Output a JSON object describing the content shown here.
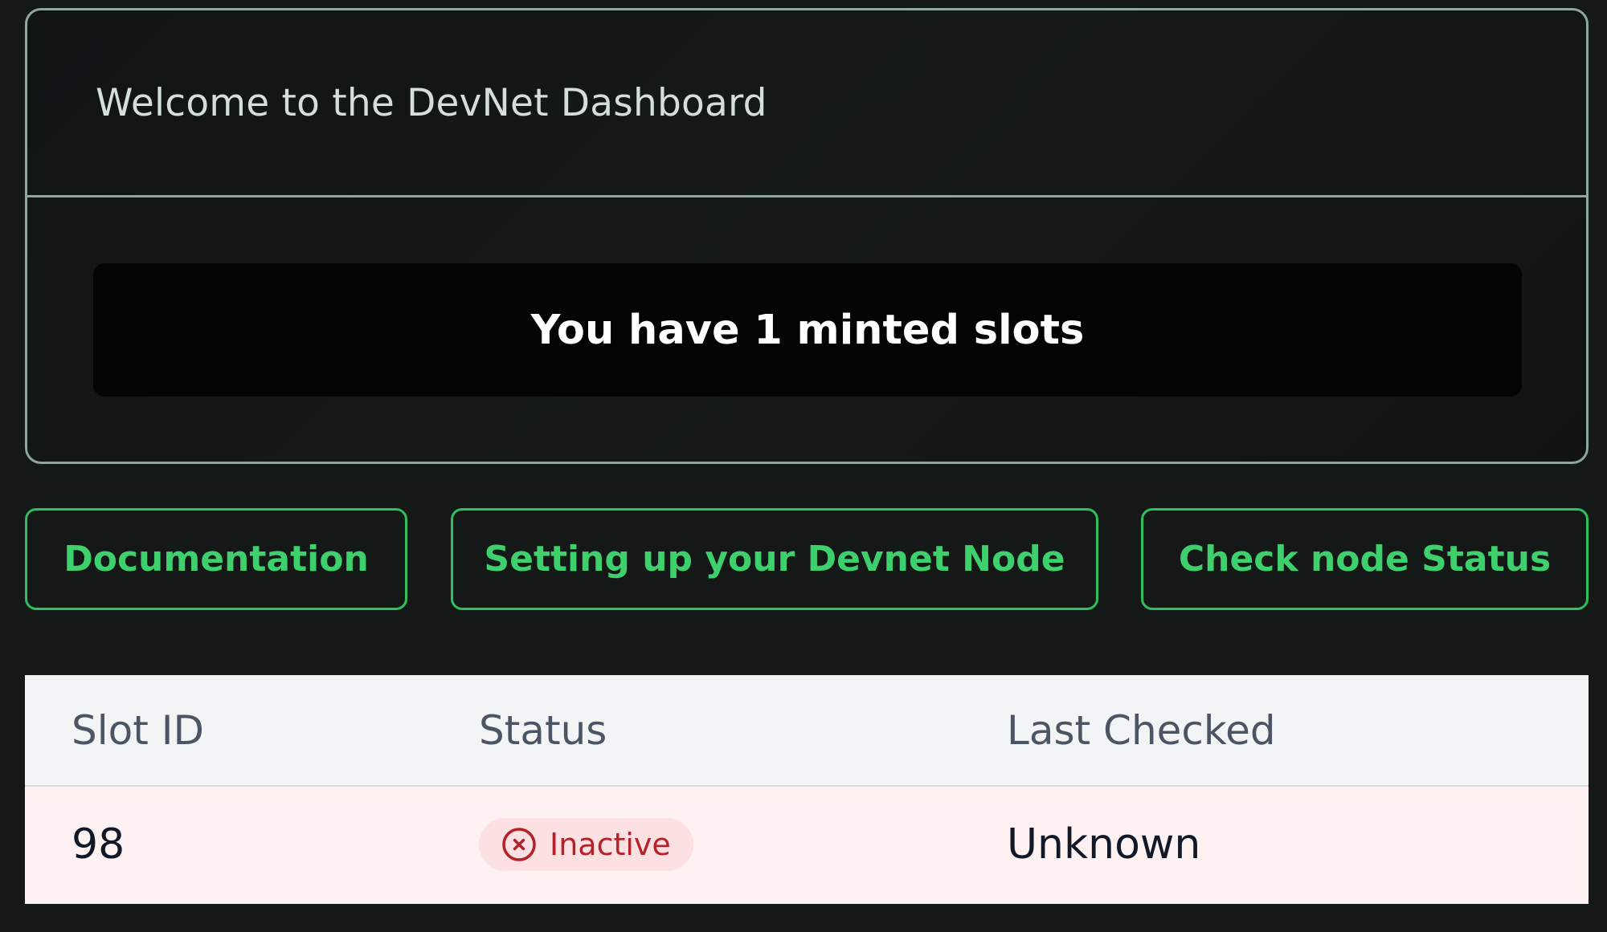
{
  "card": {
    "title": "Welcome to the DevNet Dashboard",
    "minted_message": "You have 1 minted slots"
  },
  "actions": {
    "documentation": "Documentation",
    "setup_node": "Setting up your Devnet Node",
    "check_status": "Check node Status"
  },
  "table": {
    "headers": {
      "slot_id": "Slot ID",
      "status": "Status",
      "last_checked": "Last Checked"
    },
    "rows": [
      {
        "slot_id": "98",
        "status": "Inactive",
        "status_icon": "x-circle-icon",
        "last_checked": "Unknown"
      }
    ]
  },
  "colors": {
    "accent_green": "#3fd06e",
    "inactive_red": "#b4232b",
    "inactive_bg": "#fde1e2"
  }
}
